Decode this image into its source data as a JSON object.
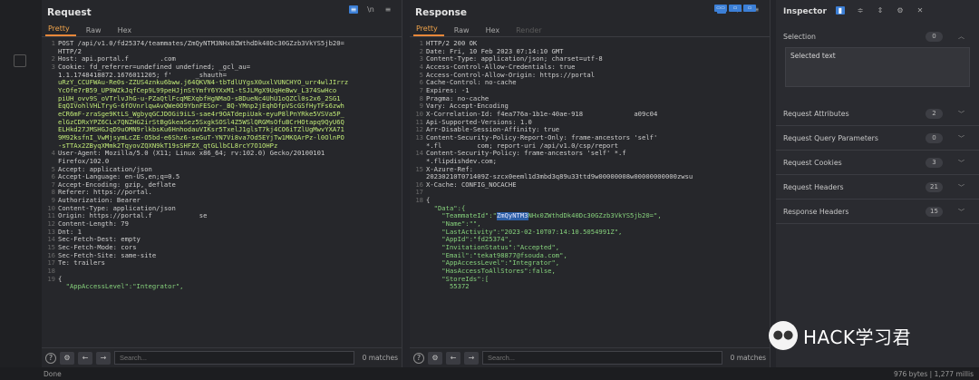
{
  "request": {
    "title": "Request",
    "tabs": [
      "Pretty",
      "Raw",
      "Hex"
    ],
    "lines": [
      {
        "n": "1",
        "segs": [
          {
            "c": "t",
            "v": "POST /api/v1.0/fd25374/teammates/ZmQyNTM3NHx0ZWthdDk40Dc30GZzb3VkYS5jb20="
          }
        ]
      },
      {
        "n": "",
        "segs": [
          {
            "c": "t",
            "v": "HTTP/2"
          }
        ]
      },
      {
        "n": "2",
        "segs": [
          {
            "c": "t",
            "v": "Host: api.portal.f        .com"
          }
        ]
      },
      {
        "n": "3",
        "segs": [
          {
            "c": "t",
            "v": "Cookie: fd_referrer=undefined undefined; _gcl_au="
          }
        ]
      },
      {
        "n": "",
        "segs": [
          {
            "c": "t",
            "v": "1.1.1748418872.1676011205; f'      _shauth="
          }
        ]
      },
      {
        "n": "",
        "segs": [
          {
            "c": "g",
            "v": "uRzY_CCUFWAu-Re0s-ZZUS4znku6bww.j64QKVN4-tbTdlUYgsX0uxlVUNCHYO_urr4wlJIrrz"
          }
        ]
      },
      {
        "n": "",
        "segs": [
          {
            "c": "g",
            "v": "YcOfe7rB59_UP9WZkJqfCep9L99peHJjnStYmfY6YXxM1-tSJLMgX9UqHeBwv_L374SwHco"
          }
        ]
      },
      {
        "n": "",
        "segs": [
          {
            "c": "g",
            "v": "piUH_ovv9S_oVTrlvJhG-u-PZaQtlFcqMEXqbfHgNMaO-sBDueNc4UhU1oQZCl0s2x6_2SG1"
          }
        ]
      },
      {
        "n": "",
        "segs": [
          {
            "c": "g",
            "v": "EqQIVohlVHLTryG-6fOVnrlqwAvQWe0O9YbnFESor-_BQ-YMnp2jEqhDfpVScGSfHyTFs6zwh"
          }
        ]
      },
      {
        "n": "",
        "segs": [
          {
            "c": "g",
            "v": "eCR6mF-zraSge9KtLS_WgbyqGCJDOGi9iLS-sae4r9OATdepiUak-eyuP8lPnYRke5VSVa5P_"
          }
        ]
      },
      {
        "n": "",
        "segs": [
          {
            "c": "g",
            "v": "elGzCDRxYPZ6CLx7QNZHG2irStBgGkeaSez5SxgkSOSl4Z5WSlQRGMsOfuBCrHOtapq9QyU6Q"
          }
        ]
      },
      {
        "n": "",
        "segs": [
          {
            "c": "g",
            "v": "ELHkd27JMSHGJqD9uOMN9rlkbsKu6HnhodauVIKsr5TxelJ1glsT7kj4CO6iTZlUgMwvYXA71"
          }
        ]
      },
      {
        "n": "",
        "segs": [
          {
            "c": "g",
            "v": "9M92ksfnI_VwMjsymLcZE-O5bd-e6Shz6-seGuT-YN7Vi8va7Od5EYjTw1MKQArPz-l0OlnPO"
          }
        ]
      },
      {
        "n": "",
        "segs": [
          {
            "c": "g",
            "v": "-sTTAx2ZByqXMmk2TqyovZQXN9kT19sSHFZX_qtGLlbCL8rcY7O1OHPz"
          }
        ]
      },
      {
        "n": "4",
        "segs": [
          {
            "c": "t",
            "v": "User-Agent: Mozilla/5.0 (X11; Linux x86_64; rv:102.0) Gecko/20100101"
          }
        ]
      },
      {
        "n": "",
        "segs": [
          {
            "c": "t",
            "v": "Firefox/102.0"
          }
        ]
      },
      {
        "n": "5",
        "segs": [
          {
            "c": "t",
            "v": "Accept: application/json"
          }
        ]
      },
      {
        "n": "6",
        "segs": [
          {
            "c": "t",
            "v": "Accept-Language: en-US,en;q=0.5"
          }
        ]
      },
      {
        "n": "7",
        "segs": [
          {
            "c": "t",
            "v": "Accept-Encoding: gzip, deflate"
          }
        ]
      },
      {
        "n": "8",
        "segs": [
          {
            "c": "t",
            "v": "Referer: https://portal."
          }
        ]
      },
      {
        "n": "9",
        "segs": [
          {
            "c": "t",
            "v": "Authorization: Bearer"
          }
        ]
      },
      {
        "n": "10",
        "segs": [
          {
            "c": "t",
            "v": "Content-Type: application/json"
          }
        ]
      },
      {
        "n": "11",
        "segs": [
          {
            "c": "t",
            "v": "Origin: https://portal.f            se"
          }
        ]
      },
      {
        "n": "12",
        "segs": [
          {
            "c": "t",
            "v": "Content-Length: 79"
          }
        ]
      },
      {
        "n": "13",
        "segs": [
          {
            "c": "t",
            "v": "Dnt: 1"
          }
        ]
      },
      {
        "n": "14",
        "segs": [
          {
            "c": "t",
            "v": "Sec-Fetch-Dest: empty"
          }
        ]
      },
      {
        "n": "15",
        "segs": [
          {
            "c": "t",
            "v": "Sec-Fetch-Mode: cors"
          }
        ]
      },
      {
        "n": "16",
        "segs": [
          {
            "c": "t",
            "v": "Sec-Fetch-Site: same-site"
          }
        ]
      },
      {
        "n": "17",
        "segs": [
          {
            "c": "t",
            "v": "Te: trailers"
          }
        ]
      },
      {
        "n": "18",
        "segs": [
          {
            "c": "t",
            "v": ""
          }
        ]
      },
      {
        "n": "19",
        "segs": [
          {
            "c": "t",
            "v": "{"
          }
        ]
      },
      {
        "n": "",
        "segs": [
          {
            "c": "s",
            "v": "  \"AppAccessLevel\":\"Integrator\","
          }
        ]
      }
    ],
    "search_placeholder": "Search...",
    "matches": "0 matches"
  },
  "response": {
    "title": "Response",
    "tabs": [
      "Pretty",
      "Raw",
      "Hex",
      "Render"
    ],
    "lines": [
      {
        "n": "1",
        "segs": [
          {
            "c": "t",
            "v": "HTTP/2 200 OK"
          }
        ]
      },
      {
        "n": "2",
        "segs": [
          {
            "c": "t",
            "v": "Date: Fri, 10 Feb 2023 07:14:10 GMT"
          }
        ]
      },
      {
        "n": "3",
        "segs": [
          {
            "c": "t",
            "v": "Content-Type: application/json; charset=utf-8"
          }
        ]
      },
      {
        "n": "4",
        "segs": [
          {
            "c": "t",
            "v": "Access-Control-Allow-Credentials: true"
          }
        ]
      },
      {
        "n": "5",
        "segs": [
          {
            "c": "t",
            "v": "Access-Control-Allow-Origin: https://portal"
          }
        ]
      },
      {
        "n": "6",
        "segs": [
          {
            "c": "t",
            "v": "Cache-Control: no-cache"
          }
        ]
      },
      {
        "n": "7",
        "segs": [
          {
            "c": "t",
            "v": "Expires: -1"
          }
        ]
      },
      {
        "n": "8",
        "segs": [
          {
            "c": "t",
            "v": "Pragma: no-cache"
          }
        ]
      },
      {
        "n": "9",
        "segs": [
          {
            "c": "t",
            "v": "Vary: Accept-Encoding"
          }
        ]
      },
      {
        "n": "10",
        "segs": [
          {
            "c": "t",
            "v": "X-Correlation-Id: f4ea776a-1b1e-40ae-918             a09c04"
          }
        ]
      },
      {
        "n": "11",
        "segs": [
          {
            "c": "t",
            "v": "Api-Supported-Versions: 1.0"
          }
        ]
      },
      {
        "n": "12",
        "segs": [
          {
            "c": "t",
            "v": "Arr-Disable-Session-Affinity: true"
          }
        ]
      },
      {
        "n": "13",
        "segs": [
          {
            "c": "t",
            "v": "Content-Security-Policy-Report-Only: frame-ancestors 'self'"
          }
        ]
      },
      {
        "n": "",
        "segs": [
          {
            "c": "t",
            "v": "*.fl         com; report-uri /api/v1.0/csp/report"
          }
        ]
      },
      {
        "n": "14",
        "segs": [
          {
            "c": "t",
            "v": "Content-Security-Policy: frame-ancestors 'self' *.f"
          }
        ]
      },
      {
        "n": "",
        "segs": [
          {
            "c": "t",
            "v": "*.flipdishdev.com;"
          }
        ]
      },
      {
        "n": "15",
        "segs": [
          {
            "c": "t",
            "v": "X-Azure-Ref:"
          }
        ]
      },
      {
        "n": "",
        "segs": [
          {
            "c": "t",
            "v": "20230210T071409Z-szcx0eeml1d3mbd3q89u33ttd9w00000008w00000000000zwsu"
          }
        ]
      },
      {
        "n": "16",
        "segs": [
          {
            "c": "t",
            "v": "X-Cache: CONFIG_NOCACHE"
          }
        ]
      },
      {
        "n": "17",
        "segs": [
          {
            "c": "t",
            "v": ""
          }
        ]
      },
      {
        "n": "18",
        "segs": [
          {
            "c": "t",
            "v": "{"
          }
        ]
      },
      {
        "n": "",
        "segs": [
          {
            "c": "s",
            "v": "  \"Data\":{"
          }
        ]
      },
      {
        "n": "",
        "segs": [
          {
            "c": "s",
            "v": "    \"TeammateId\":\""
          },
          {
            "c": "hl",
            "v": "ZmQyNTM3"
          },
          {
            "c": "s",
            "v": "NHx0ZWthdDk40Dc30GZzb3VkYS5jb20=\","
          }
        ]
      },
      {
        "n": "",
        "segs": [
          {
            "c": "s",
            "v": "    \"Name\":\"\","
          }
        ]
      },
      {
        "n": "",
        "segs": [
          {
            "c": "s",
            "v": "    \"LastActivity\":\"2023-02-10T07:14:10.5054991Z\","
          }
        ]
      },
      {
        "n": "",
        "segs": [
          {
            "c": "s",
            "v": "    \"AppId\":\"fd25374\","
          }
        ]
      },
      {
        "n": "",
        "segs": [
          {
            "c": "s",
            "v": "    \"InvitationStatus\":\"Accepted\","
          }
        ]
      },
      {
        "n": "",
        "segs": [
          {
            "c": "s",
            "v": "    \"Email\":\"tekat98877@fsouda.com\","
          }
        ]
      },
      {
        "n": "",
        "segs": [
          {
            "c": "s",
            "v": "    \"AppAccessLevel\":\"Integrator\","
          }
        ]
      },
      {
        "n": "",
        "segs": [
          {
            "c": "s",
            "v": "    \"HasAccessToAllStores\":false,"
          }
        ]
      },
      {
        "n": "",
        "segs": [
          {
            "c": "s",
            "v": "    \"StoreIds\":["
          }
        ]
      },
      {
        "n": "",
        "segs": [
          {
            "c": "s",
            "v": "      55372"
          }
        ]
      }
    ],
    "search_placeholder": "Search...",
    "matches": "0 matches"
  },
  "inspector": {
    "title": "Inspector",
    "selection_label": "Selection",
    "selection_count": "0",
    "selected_text_label": "Selected text",
    "sections": [
      {
        "label": "Request Attributes",
        "count": "2"
      },
      {
        "label": "Request Query Parameters",
        "count": "0"
      },
      {
        "label": "Request Cookies",
        "count": "3"
      },
      {
        "label": "Request Headers",
        "count": "21"
      },
      {
        "label": "Response Headers",
        "count": "15"
      }
    ]
  },
  "status": {
    "left": "Done",
    "right": "976 bytes | 1,277 millis"
  },
  "watermark": "HACK学习君"
}
